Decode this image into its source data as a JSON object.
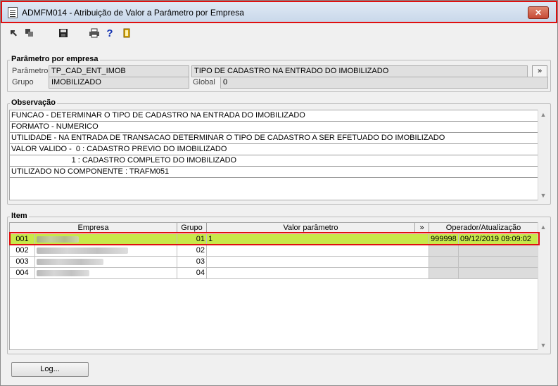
{
  "window": {
    "title": "ADMFM014 - Atribuição de Valor a Parâmetro por Empresa",
    "close_label": "✕"
  },
  "toolbar": {
    "icons": [
      "first-record-icon",
      "copy-icon",
      "save-icon",
      "print-icon",
      "help-icon",
      "exit-icon"
    ],
    "help_glyph": "?"
  },
  "param_group": {
    "title": "Parâmetro por empresa",
    "param_label": "Parâmetro",
    "param_code": "TP_CAD_ENT_IMOB",
    "param_description": "TIPO DE CADASTRO NA ENTRADO DO IMOBILIZADO",
    "expand_label": "»",
    "group_label": "Grupo",
    "group_value": "IMOBILIZADO",
    "global_label": "Global",
    "global_value": "0"
  },
  "observation": {
    "title": "Observação",
    "lines": [
      "FUNCAO - DETERMINAR O TIPO DE CADASTRO NA ENTRADA DO IMOBILIZADO",
      "FORMATO - NUMERICO",
      "UTILIDADE - NA ENTRADA DE TRANSACAO DETERMINAR O TIPO DE CADASTRO A SER EFETUADO DO IMOBILIZADO",
      "VALOR VALIDO -  0 : CADASTRO PREVIO DO IMOBILIZADO",
      "                            1 : CADASTRO COMPLETO DO IMOBILIZADO",
      "UTILIZADO NO COMPONENTE : TRAFM051"
    ]
  },
  "items": {
    "title": "Item",
    "columns": {
      "empresa": "Empresa",
      "grupo": "Grupo",
      "valor": "Valor parâmetro",
      "expand": "»",
      "operador": "Operador/Atualização"
    },
    "rows": [
      {
        "code": "001",
        "grupo": "01",
        "valor": "1",
        "operador": "999998",
        "data": "09/12/2019 09:09:02"
      },
      {
        "code": "002",
        "grupo": "02",
        "valor": "",
        "operador": "",
        "data": ""
      },
      {
        "code": "003",
        "grupo": "03",
        "valor": "",
        "operador": "",
        "data": ""
      },
      {
        "code": "004",
        "grupo": "04",
        "valor": "",
        "operador": "",
        "data": ""
      }
    ]
  },
  "footer": {
    "log_label": "Log..."
  },
  "colors": {
    "highlight_row": "#c8e84a",
    "outline": "#e01010"
  }
}
